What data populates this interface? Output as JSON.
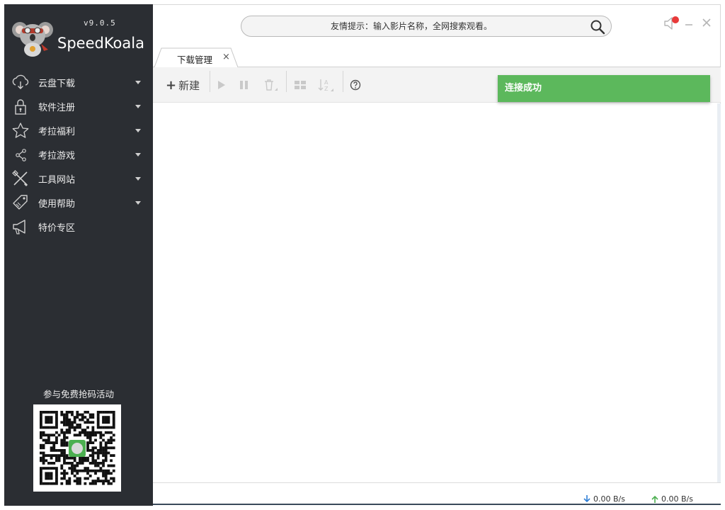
{
  "app": {
    "version": "v9.0.5",
    "name": "SpeedKoala"
  },
  "sidebar": {
    "items": [
      {
        "label": "云盘下载",
        "icon": "cloud-download-icon",
        "has_caret": true
      },
      {
        "label": "软件注册",
        "icon": "lock-icon",
        "has_caret": true
      },
      {
        "label": "考拉福利",
        "icon": "star-icon",
        "has_caret": true
      },
      {
        "label": "考拉游戏",
        "icon": "share-icon",
        "has_caret": true
      },
      {
        "label": "工具网站",
        "icon": "tools-icon",
        "has_caret": true
      },
      {
        "label": "使用帮助",
        "icon": "tag-icon",
        "has_caret": true
      },
      {
        "label": "特价专区",
        "icon": "megaphone-icon",
        "has_caret": false
      }
    ],
    "promo_text": "参与免费抢码活动"
  },
  "search": {
    "placeholder": "友情提示：输入影片名称，全网搜索观看。"
  },
  "tabs": [
    {
      "label": "下载管理",
      "close": "×"
    }
  ],
  "toolbar": {
    "new_label": "新建"
  },
  "toast": {
    "text": "连接成功",
    "color": "#5cb85c"
  },
  "status": {
    "download_speed": "0.00 B/s",
    "upload_speed": "0.00 B/s"
  },
  "colors": {
    "sidebar_bg": "#2b2e33",
    "accent_green": "#5cb85c",
    "notify_red": "#e83a3a"
  }
}
